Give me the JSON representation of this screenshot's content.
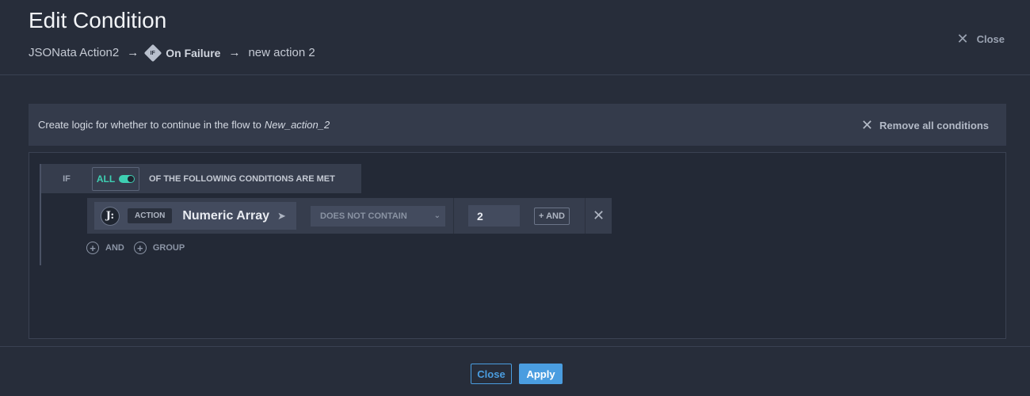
{
  "header": {
    "title": "Edit Condition",
    "breadcrumb": {
      "item1": "JSONata Action2",
      "badge": "IF",
      "item2": "On Failure",
      "item3": "new action 2"
    },
    "close_label": "Close"
  },
  "banner": {
    "text": "Create logic for whether to continue in the flow to",
    "target": "New_action_2",
    "remove_all_label": "Remove all conditions"
  },
  "logic": {
    "if_label": "IF",
    "toggle_label": "ALL",
    "toggle_on": true,
    "conditions_text": "OF THE FOLLOWING CONDITIONS ARE MET"
  },
  "condition": {
    "icon_glyph": "J:",
    "source_tag": "ACTION",
    "field": "Numeric Array",
    "operator": "DOES NOT CONTAIN",
    "value": "2",
    "and_label": "+ AND"
  },
  "add": {
    "and_label": "AND",
    "group_label": "GROUP"
  },
  "footer": {
    "close_label": "Close",
    "apply_label": "Apply"
  },
  "icons": {
    "arrow": "→",
    "close": "✕",
    "cursor": "➤",
    "chevron": "⌄",
    "plus": "+"
  },
  "colors": {
    "accent": "#4a9de0",
    "toggle": "#3ecfb2"
  }
}
